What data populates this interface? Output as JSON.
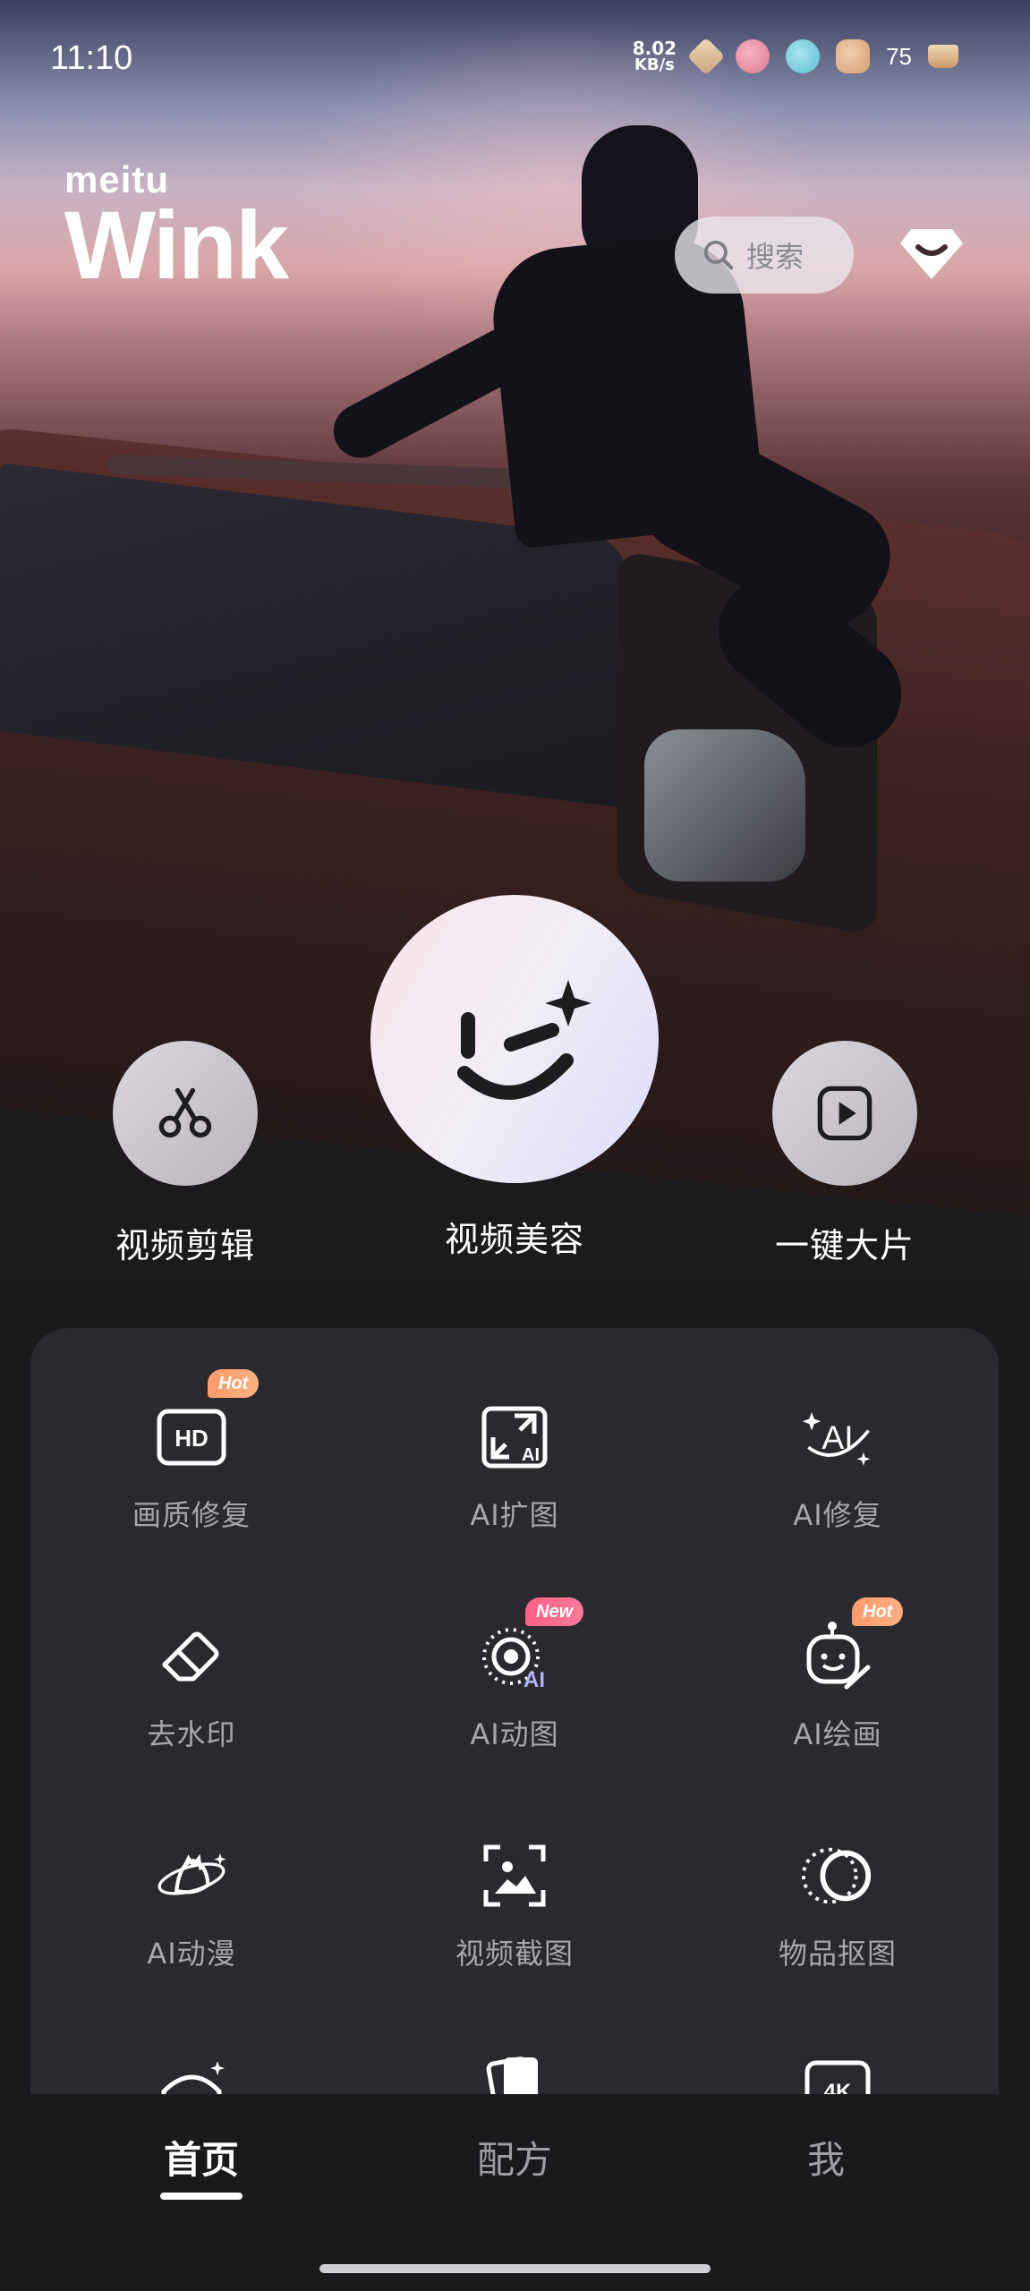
{
  "status_bar": {
    "time": "11:10",
    "net_speed_value": "8.02",
    "net_speed_unit": "KB/s",
    "battery": "75"
  },
  "logo": {
    "brand_small": "meitu",
    "brand_big": "Wink"
  },
  "search": {
    "placeholder": "搜索",
    "icon": "search-icon"
  },
  "main_actions": [
    {
      "label": "视频剪辑",
      "icon": "scissors-icon"
    },
    {
      "label": "视频美容",
      "icon": "wink-face-icon"
    },
    {
      "label": "一键大片",
      "icon": "play-icon"
    }
  ],
  "tools": [
    {
      "label": "画质修复",
      "icon": "hd-icon",
      "badge": "Hot"
    },
    {
      "label": "AI扩图",
      "icon": "ai-expand-icon",
      "badge": ""
    },
    {
      "label": "AI修复",
      "icon": "ai-repair-icon",
      "badge": ""
    },
    {
      "label": "去水印",
      "icon": "eraser-icon",
      "badge": ""
    },
    {
      "label": "AI动图",
      "icon": "ai-motion-icon",
      "badge": "New"
    },
    {
      "label": "AI绘画",
      "icon": "ai-painting-icon",
      "badge": "Hot"
    },
    {
      "label": "AI动漫",
      "icon": "ai-anime-icon",
      "badge": ""
    },
    {
      "label": "视频截图",
      "icon": "video-screenshot-icon",
      "badge": ""
    },
    {
      "label": "物品抠图",
      "icon": "object-cutout-icon",
      "badge": ""
    }
  ],
  "bottom_nav": [
    {
      "label": "首页",
      "active": true
    },
    {
      "label": "配方",
      "active": false
    },
    {
      "label": "我",
      "active": false
    }
  ],
  "colors": {
    "hot_badge": "#ff9a6b",
    "new_badge": "#ff5f86",
    "panel_bg": "#2a2a2e",
    "page_bg": "#1a1a1d"
  }
}
